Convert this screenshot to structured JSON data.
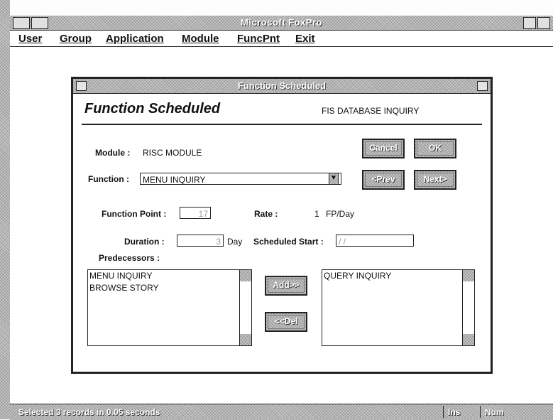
{
  "app": {
    "title": "Microsoft FoxPro"
  },
  "menu": [
    "User",
    "Group",
    "Application",
    "Module",
    "FuncPnt",
    "Exit"
  ],
  "dialog": {
    "title": "Function Scheduled",
    "heading": "Function Scheduled",
    "subheading": "FIS DATABASE INQUIRY",
    "module_label": "Module :",
    "module_value": "RISC MODULE",
    "function_label": "Function :",
    "function_value": "MENU INQUIRY",
    "function_point_label": "Function Point :",
    "function_point_value": "17",
    "rate_label": "Rate :",
    "rate_value": "1",
    "rate_unit": "FP/Day",
    "duration_label": "Duration :",
    "duration_value": "3",
    "duration_unit": "Day",
    "scheduled_start_label": "Scheduled Start :",
    "scheduled_start_value": "/ /",
    "predecessors_label": "Predecessors :",
    "left_list": [
      "MENU INQUIRY",
      "BROWSE STORY"
    ],
    "right_list": [
      "QUERY INQUIRY"
    ],
    "buttons": {
      "cancel": "Cancel",
      "ok": "OK",
      "prev": "<Prev",
      "next": "Next>",
      "add": "Add>>",
      "del": "<<Del"
    }
  },
  "status": {
    "message": "Selected 3 records in 0.05 seconds",
    "ins": "Ins",
    "num": "Num"
  }
}
